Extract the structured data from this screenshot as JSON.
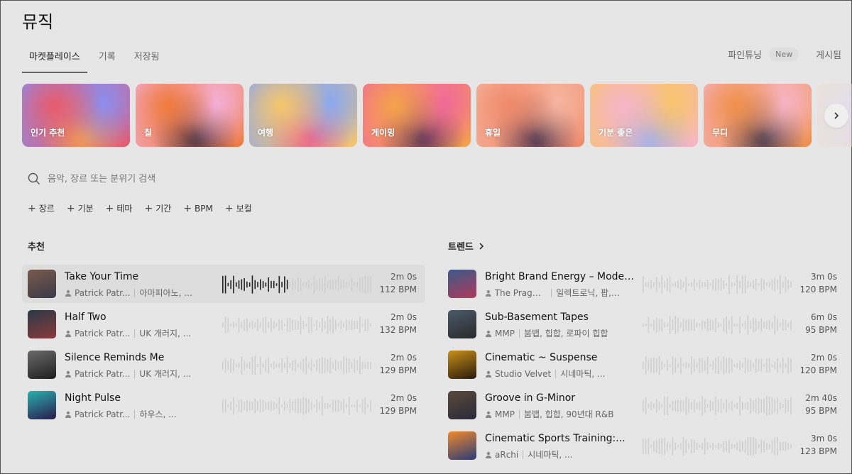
{
  "page": {
    "title": "뮤직"
  },
  "tabs": [
    {
      "label": "마켓플레이스",
      "active": true
    },
    {
      "label": "기록",
      "active": false
    },
    {
      "label": "저장됨",
      "active": false
    }
  ],
  "right_tabs": {
    "finetune": "파인튜닝",
    "new_badge": "New",
    "published": "게시됨"
  },
  "categories": [
    {
      "label": "인기 추천",
      "colors": [
        "#e85b6c",
        "#f7a14c",
        "#8a8ef0"
      ]
    },
    {
      "label": "칠",
      "colors": [
        "#f07a3c",
        "#3a2a3e",
        "#f4b0d8"
      ]
    },
    {
      "label": "여행",
      "colors": [
        "#f7c66b",
        "#f05a8a",
        "#8aa8f0"
      ]
    },
    {
      "label": "게이밍",
      "colors": [
        "#f5a34a",
        "#4a2a55",
        "#f26a9a"
      ]
    },
    {
      "label": "휴일",
      "colors": [
        "#f08a6a",
        "#3a2a4a",
        "#f6b5a0"
      ]
    },
    {
      "label": "기분 좋은",
      "colors": [
        "#f6b5c8",
        "#9ab0f0",
        "#f7c46b"
      ]
    },
    {
      "label": "무디",
      "colors": [
        "#f0904a",
        "#35304a",
        "#f7b5c5"
      ]
    },
    {
      "label": "",
      "colors": [
        "#e0d8f0",
        "#f0c8d8",
        "#f4e0c0"
      ]
    }
  ],
  "search": {
    "placeholder": "음악, 장르 또는 분위기 검색"
  },
  "filters": [
    "장르",
    "기분",
    "테마",
    "기간",
    "BPM",
    "보컬"
  ],
  "sections": {
    "recommended": "추천",
    "trending": "트렌드"
  },
  "recommended": [
    {
      "title": "Take Your Time",
      "artist": "Patrick Patr...",
      "tags": "아마피아노, ...",
      "duration": "2m 0s",
      "bpm": "112 BPM",
      "thumb": [
        "#7a5a4a",
        "#3a3a4a"
      ]
    },
    {
      "title": "Half Two",
      "artist": "Patrick Patr...",
      "tags": "UK 개러지, ...",
      "duration": "2m 0s",
      "bpm": "132 BPM",
      "thumb": [
        "#2a3a4a",
        "#8a3a3a"
      ]
    },
    {
      "title": "Silence Reminds Me",
      "artist": "Patrick Patr...",
      "tags": "UK 개러지, ...",
      "duration": "2m 0s",
      "bpm": "129 BPM",
      "thumb": [
        "#6a6a6a",
        "#1e1e1e"
      ]
    },
    {
      "title": "Night Pulse",
      "artist": "Patrick Patr...",
      "tags": "하우스, ...",
      "duration": "2m 0s",
      "bpm": "129 BPM",
      "thumb": [
        "#2ab0b0",
        "#2a1a4a"
      ]
    }
  ],
  "trending": [
    {
      "title": "Bright Brand Energy – Moder...",
      "artist": "The Pragm...",
      "tags": "일렉트로닉, 팝, ...",
      "duration": "3m 0s",
      "bpm": "120 BPM",
      "thumb": [
        "#3a5a8a",
        "#b03a5a"
      ]
    },
    {
      "title": "Sub-Basement Tapes",
      "artist": "MMP",
      "tags": "붐뱁, 힙합, 로파이 힙합",
      "duration": "6m 0s",
      "bpm": "95 BPM",
      "thumb": [
        "#4a5a6a",
        "#2a2a2a"
      ]
    },
    {
      "title": "Cinematic ~ Suspense",
      "artist": "Studio Velvet",
      "tags": "시네마틱, ...",
      "duration": "2m 0s",
      "bpm": "120 BPM",
      "thumb": [
        "#c8901a",
        "#2a1a0a"
      ]
    },
    {
      "title": "Groove in G-Minor",
      "artist": "MMP",
      "tags": "붐뱁, 힙합, 90년대 R&B",
      "duration": "2m 40s",
      "bpm": "95 BPM",
      "thumb": [
        "#5a4a3a",
        "#2a2a3a"
      ]
    },
    {
      "title": "Cinematic Sports Training:...",
      "artist": "aRchi",
      "tags": "시네마틱, ...",
      "duration": "3m 0s",
      "bpm": "123 BPM",
      "thumb": [
        "#f08a2a",
        "#2a3a7a"
      ]
    }
  ]
}
